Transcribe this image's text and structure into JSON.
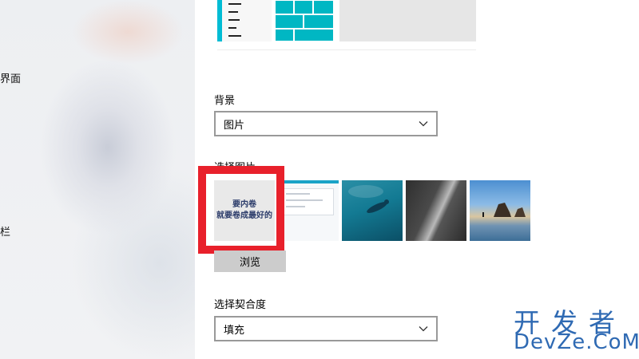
{
  "sidebar": {
    "items": [
      {
        "label": "界面"
      },
      {
        "label": "栏"
      }
    ]
  },
  "background": {
    "label": "背景",
    "selected": "图片"
  },
  "choose_picture": {
    "label": "选择图片",
    "thumbnails": [
      {
        "name": "custom-image",
        "text_line1": "要内卷",
        "text_line2": "就要卷成最好的"
      },
      {
        "name": "screenshot-image"
      },
      {
        "name": "underwater-image"
      },
      {
        "name": "rock-image"
      },
      {
        "name": "beach-image"
      }
    ],
    "browse_label": "浏览"
  },
  "fit": {
    "label": "选择契合度",
    "selected": "填充"
  },
  "watermark": {
    "cn": "开发者",
    "en": "DevZe.CoM"
  },
  "colors": {
    "accent": "#00b7c3",
    "highlight": "#e8202b",
    "watermark": "#2f6ab3"
  }
}
